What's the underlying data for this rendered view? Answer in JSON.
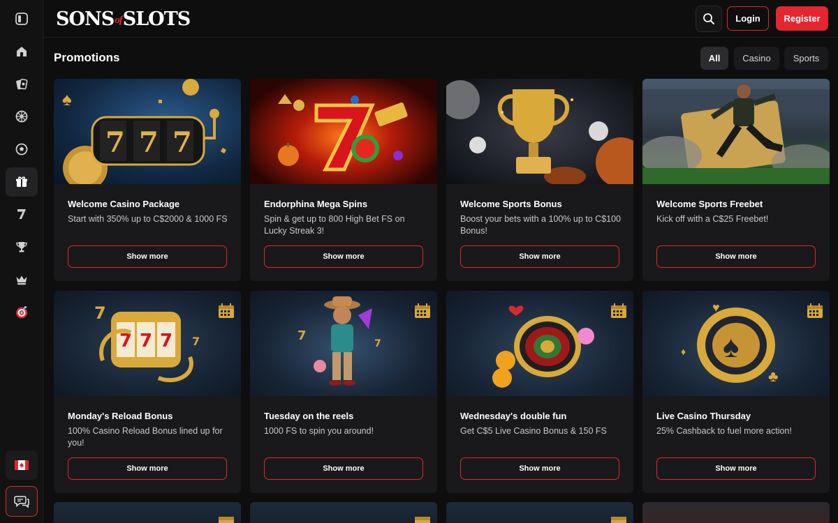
{
  "brand": {
    "logo_left": "SONS",
    "logo_of": "of",
    "logo_right": "SLOTS"
  },
  "header": {
    "login_label": "Login",
    "register_label": "Register"
  },
  "page": {
    "title": "Promotions"
  },
  "filters": [
    "All",
    "Casino",
    "Sports"
  ],
  "sidebar": {
    "items": [
      "sidebar-toggle",
      "home",
      "casino",
      "live-casino",
      "sports",
      "promotions",
      "slots",
      "tournaments",
      "vip",
      "wheel"
    ],
    "active": "promotions"
  },
  "cards": [
    {
      "title": "Welcome Casino Package",
      "desc": "Start with 350% up to C$2000 & 1000 FS",
      "button": "Show more",
      "art": "777",
      "bg": "#17324f"
    },
    {
      "title": "Endorphina Mega Spins",
      "desc": "Spin & get up to 800 High Bet FS on Lucky Streak 3!",
      "button": "Show more",
      "art": "7",
      "bg": "#5a0e08"
    },
    {
      "title": "Welcome Sports Bonus",
      "desc": "Boost your bets with a 100% up to C$100 Bonus!",
      "button": "Show more",
      "art": "trophy",
      "bg": "#20232c"
    },
    {
      "title": "Welcome Sports Freebet",
      "desc": "Kick off with a C$25 Freebet!",
      "button": "Show more",
      "art": "player",
      "bg": "#2a3a4a"
    },
    {
      "title": "Monday's Reload Bonus",
      "desc": "100% Casino Reload Bonus lined up for you!",
      "button": "Show more",
      "art": "777",
      "bg": "#182536"
    },
    {
      "title": "Tuesday on the reels",
      "desc": "1000 FS to spin you around!",
      "button": "Show more",
      "art": "cowboy",
      "bg": "#182536"
    },
    {
      "title": "Wednesday's double fun",
      "desc": "Get C$5 Live Casino Bonus & 150 FS",
      "button": "Show more",
      "art": "roulette",
      "bg": "#182536"
    },
    {
      "title": "Live Casino Thursday",
      "desc": "25% Cashback to fuel more action!",
      "button": "Show more",
      "art": "chip",
      "bg": "#182536"
    }
  ],
  "colors": {
    "accent": "#e3262f",
    "background": "#0e0e0f",
    "card": "#19191b",
    "gold": "#d9a93a"
  }
}
